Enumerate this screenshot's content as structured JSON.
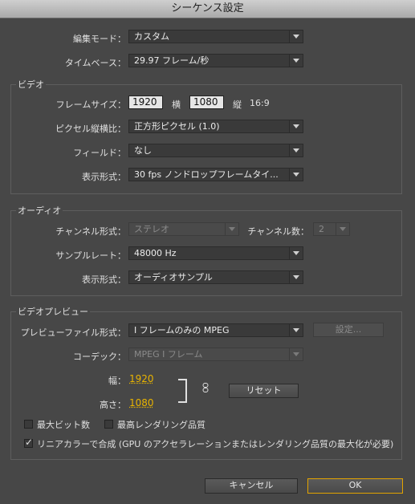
{
  "window": {
    "title": "シーケンス設定"
  },
  "top": {
    "edit_mode": {
      "label": "編集モード：",
      "value": "カスタム"
    },
    "timebase": {
      "label": "タイムベース：",
      "value": "29.97 フレーム/秒"
    }
  },
  "video": {
    "title": "ビデオ",
    "frame_size": {
      "label": "フレームサイズ：",
      "width": "1920",
      "h_label": "横",
      "height": "1080",
      "v_label": "縦",
      "aspect": "16:9"
    },
    "pixel_aspect": {
      "label": "ピクセル縦横比：",
      "value": "正方形ピクセル (1.0)"
    },
    "fields": {
      "label": "フィールド：",
      "value": "なし"
    },
    "display_format": {
      "label": "表示形式：",
      "value": "30 fps ノンドロップフレームタイ..."
    }
  },
  "audio": {
    "title": "オーディオ",
    "channel_format": {
      "label": "チャンネル形式：",
      "value": "ステレオ"
    },
    "channel_count": {
      "label": "チャンネル数：",
      "value": "2"
    },
    "sample_rate": {
      "label": "サンプルレート：",
      "value": "48000 Hz"
    },
    "display_format": {
      "label": "表示形式：",
      "value": "オーディオサンプル"
    }
  },
  "preview": {
    "title": "ビデオプレビュー",
    "file_format": {
      "label": "プレビューファイル形式：",
      "value": "I フレームのみの MPEG"
    },
    "settings_button": "設定...",
    "codec": {
      "label": "コーデック：",
      "value": "MPEG I フレーム"
    },
    "width": {
      "label": "幅：",
      "value": "1920"
    },
    "height": {
      "label": "高さ：",
      "value": "1080"
    },
    "reset_button": "リセット",
    "max_bit_depth": {
      "label": "最大ビット数",
      "checked": false
    },
    "max_render_quality": {
      "label": "最高レンダリング品質",
      "checked": false
    },
    "linear_color": {
      "label": "リニアカラーで合成 (GPU のアクセラレーションまたはレンダリング品質の最大化が必要)",
      "checked": true
    }
  },
  "buttons": {
    "cancel": "キャンセル",
    "ok": "OK"
  },
  "colors": {
    "accent": "#e9b400",
    "background": "#474747"
  }
}
